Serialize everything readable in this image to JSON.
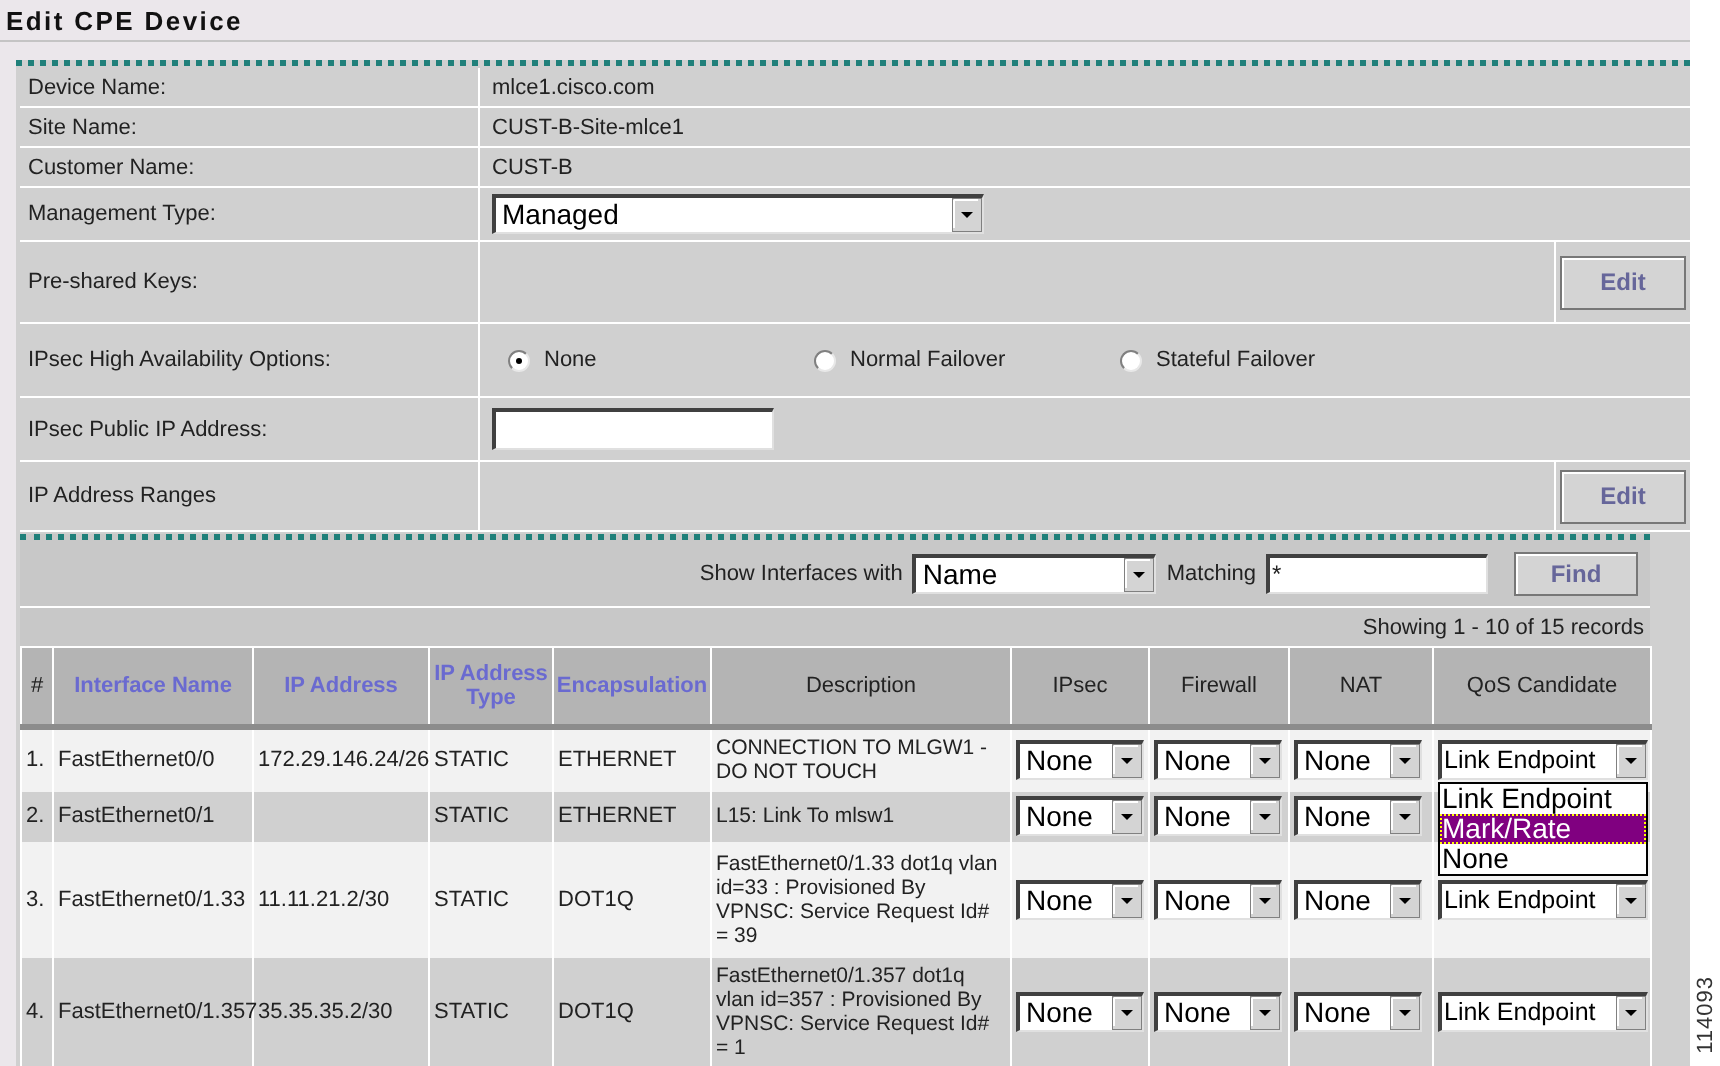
{
  "title": "Edit CPE Device",
  "form_rows": [
    {
      "kind": "text",
      "label": "Device Name:",
      "value": "mlce1.cisco.com"
    },
    {
      "kind": "text",
      "label": "Site Name:",
      "value": "CUST-B-Site-mlce1"
    },
    {
      "kind": "text",
      "label": "Customer Name:",
      "value": "CUST-B"
    },
    {
      "kind": "select",
      "label": "Management Type:",
      "value": "Managed"
    },
    {
      "kind": "button",
      "label": "Pre-shared Keys:",
      "button": "Edit"
    },
    {
      "kind": "radio",
      "label": "IPsec High Availability Options:",
      "options": [
        {
          "label": "None",
          "selected": true
        },
        {
          "label": "Normal Failover",
          "selected": false
        },
        {
          "label": "Stateful Failover",
          "selected": false
        }
      ]
    },
    {
      "kind": "input",
      "label": "IPsec Public IP Address:"
    },
    {
      "kind": "button",
      "label": "IP Address Ranges",
      "button": "Edit"
    }
  ],
  "filter": {
    "label": "Show Interfaces with",
    "field": "Name",
    "matching_label": "Matching",
    "matching_value": "*",
    "button": "Find"
  },
  "records": "Showing 1 - 10 of 15 records",
  "columns": [
    {
      "label": "#",
      "sortable": false
    },
    {
      "label": "Interface Name",
      "sortable": true
    },
    {
      "label": "IP Address",
      "sortable": true
    },
    {
      "label": "IP Address Type",
      "sortable": true
    },
    {
      "label": "Encapsulation",
      "sortable": true
    },
    {
      "label": "Description",
      "sortable": false
    },
    {
      "label": "IPsec",
      "sortable": false
    },
    {
      "label": "Firewall",
      "sortable": false
    },
    {
      "label": "NAT",
      "sortable": false
    },
    {
      "label": "QoS Candidate",
      "sortable": false
    }
  ],
  "rows": [
    {
      "number": "1.",
      "name": "FastEthernet0/0",
      "ip": "172.29.146.24/26",
      "ip_type": "STATIC",
      "encapsulation": "ETHERNET",
      "description": "CONNECTION TO MLGW1 - DO NOT TOUCH",
      "ipsec": "None",
      "firewall": "None",
      "nat": "None",
      "qos": "Link Endpoint",
      "qos_menu": [
        {
          "label": "Link Endpoint",
          "selected": false
        },
        {
          "label": "Mark/Rate",
          "selected": true
        },
        {
          "label": "None",
          "selected": false
        }
      ]
    },
    {
      "number": "2.",
      "name": "FastEthernet0/1",
      "ip_type": "STATIC",
      "encapsulation": "ETHERNET",
      "description": "L15: Link To mlsw1",
      "ipsec": "None",
      "firewall": "None",
      "nat": "None"
    },
    {
      "number": "3.",
      "name": "FastEthernet0/1.33",
      "ip": "11.11.21.2/30",
      "ip_type": "STATIC",
      "encapsulation": "DOT1Q",
      "description": "FastEthernet0/1.33 dot1q vlan id=33 : Provisioned By VPNSC: Service Request Id# = 39",
      "ipsec": "None",
      "firewall": "None",
      "nat": "None",
      "qos": "Link Endpoint"
    },
    {
      "number": "4.",
      "name": "FastEthernet0/1.357",
      "ip": "35.35.35.2/30",
      "ip_type": "STATIC",
      "encapsulation": "DOT1Q",
      "description": "FastEthernet0/1.357 dot1q vlan id=357 : Provisioned By VPNSC: Service Request Id# = 1",
      "ipsec": "None",
      "firewall": "None",
      "nat": "None",
      "qos": "Link Endpoint"
    }
  ],
  "figure_number": "114093"
}
